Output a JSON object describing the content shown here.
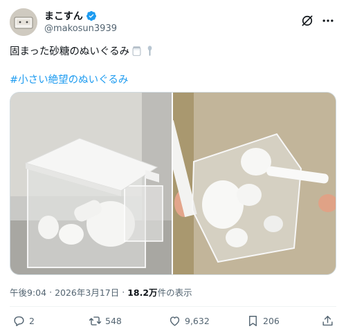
{
  "user": {
    "display_name": "まこすん",
    "handle": "@makosun3939"
  },
  "tweet": {
    "text": "固まった砂糖のぬいぐるみ",
    "emojis": [
      "sugar-jar-emoji",
      "spoon-emoji"
    ],
    "hashtag": "#小さい絶望のぬいぐるみ"
  },
  "meta": {
    "time": "午後9:04",
    "separator": "·",
    "date": "2026年3月17日",
    "views_count": "18.2万",
    "views_label": " 件の表示"
  },
  "actions": {
    "replies": "2",
    "retweets": "548",
    "likes": "9,632",
    "bookmarks": "206"
  },
  "colors": {
    "link": "#1d9bf0",
    "secondary_text": "#536471",
    "primary_text": "#0f1419",
    "border": "#cfd9de"
  }
}
